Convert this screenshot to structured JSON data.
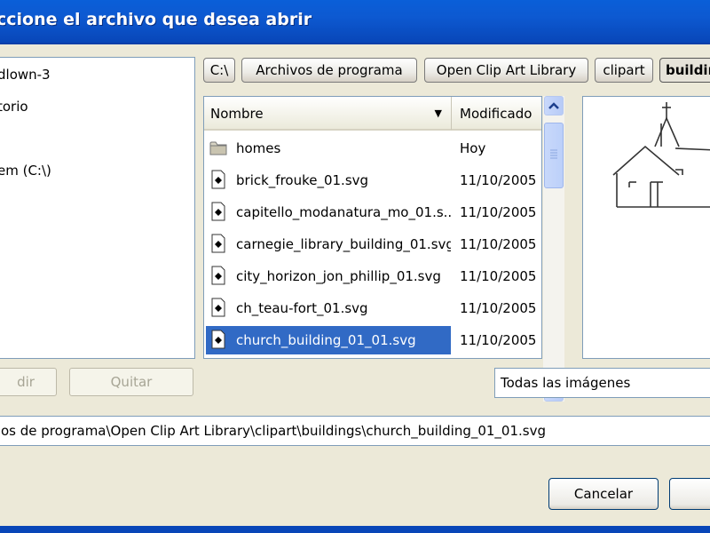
{
  "window": {
    "title": "ccione el archivo que desea abrir"
  },
  "places": [
    {
      "label": "dlown-3",
      "icon": "folder-icon"
    },
    {
      "label": "torio",
      "icon": "folder-icon"
    },
    {
      "label": "em (C:\\)",
      "icon": "drive-icon"
    }
  ],
  "path_buttons": [
    {
      "label": "C:\\"
    },
    {
      "label": "Archivos de programa"
    },
    {
      "label": "Open Clip Art Library"
    },
    {
      "label": "clipart"
    },
    {
      "label": "buildir"
    }
  ],
  "file_list": {
    "columns": {
      "name": "Nombre",
      "modified": "Modificado"
    },
    "rows": [
      {
        "name": "homes",
        "date": "Hoy",
        "icon": "folder-icon"
      },
      {
        "name": "brick_frouke_01.svg",
        "date": "11/10/2005",
        "icon": "svg-file-icon"
      },
      {
        "name": "capitello_modanatura_mo_01.s...",
        "date": "11/10/2005",
        "icon": "svg-file-icon"
      },
      {
        "name": "carnegie_library_building_01.svg",
        "date": "11/10/2005",
        "icon": "svg-file-icon"
      },
      {
        "name": "city_horizon_jon_phillip_01.svg",
        "date": "11/10/2005",
        "icon": "svg-file-icon"
      },
      {
        "name": "ch_teau-fort_01.svg",
        "date": "11/10/2005",
        "icon": "svg-file-icon"
      },
      {
        "name": "church_building_01_01.svg",
        "date": "11/10/2005",
        "icon": "svg-file-icon",
        "selected": true
      }
    ]
  },
  "buttons": {
    "add": "dir",
    "remove": "Quitar",
    "cancel": "Cancelar"
  },
  "filter": {
    "selected": "Todas las imágenes"
  },
  "location": {
    "value": "os de programa\\Open Clip Art Library\\clipart\\buildings\\church_building_01_01.svg"
  }
}
